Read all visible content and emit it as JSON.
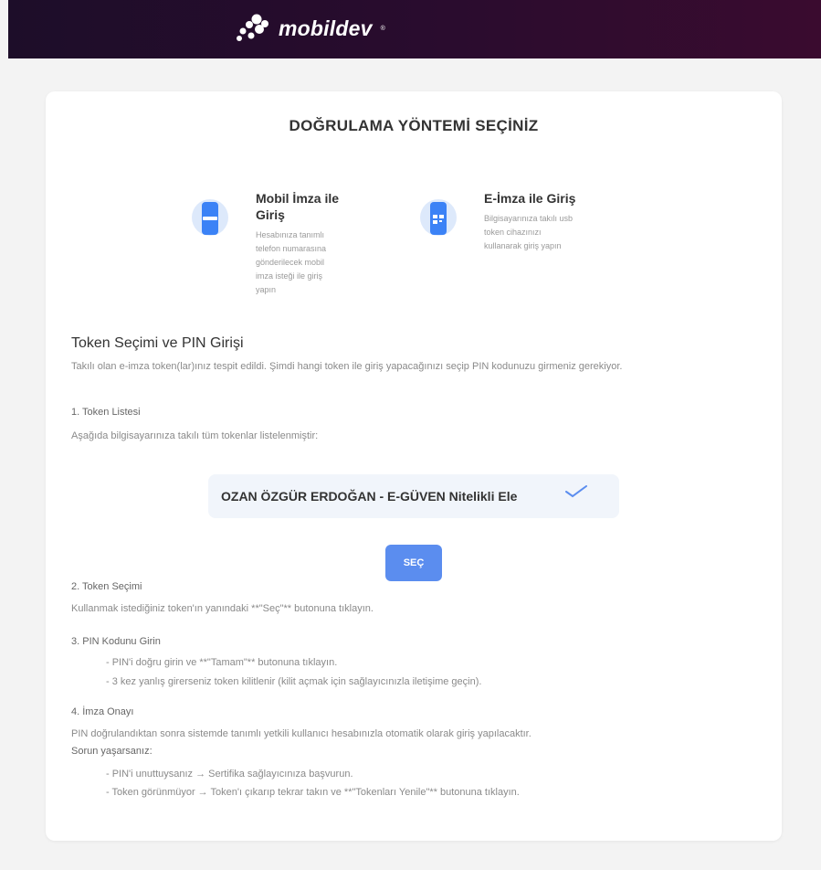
{
  "header": {
    "logo_text": "mobildev",
    "logo_mark": "®"
  },
  "page": {
    "title": "DOĞRULAMA YÖNTEMİ SEÇİNİZ"
  },
  "methods": [
    {
      "title_lines": [
        "Mobil İmza ile",
        "Giriş"
      ],
      "desc_lines": [
        "Hesabınıza tanımlı",
        "telefon numarasına",
        "gönderilecek mobil",
        "imza isteği ile giriş",
        "yapın"
      ],
      "icon": "mobile-signature-icon"
    },
    {
      "title_lines": [
        "E-İmza ile Giriş"
      ],
      "desc_lines": [
        "Bilgisayarınıza takılı usb",
        "token cihazınızı",
        "kullanarak giriş yapın"
      ],
      "icon": "qr-token-icon"
    }
  ],
  "token_section": {
    "title": "Token Seçimi ve PIN Girişi",
    "intro": "Takılı olan e-imza token(lar)ınız tespit edildi. Şimdi hangi token ile giriş yapacağınızı seçip PIN kodunuzu girmeniz gerekiyor.",
    "step1_title": "1. Token Listesi",
    "step1_text": "Aşağıda bilgisayarınıza takılı tüm tokenlar listelenmiştir:",
    "token_name": "OZAN ÖZGÜR ERDOĞAN - E-GÜVEN Nitelikli Ele",
    "select_button": "SEÇ",
    "step2_title": "2. Token Seçimi",
    "step2_text": "Kullanmak istediğiniz token'ın yanındaki **\"Seç\"** butonuna tıklayın.",
    "step3_title": "3. PIN Kodunu Girin",
    "step3_items": [
      "- PIN'i doğru girin ve **\"Tamam\"** butonuna tıklayın.",
      "- 3 kez yanlış girerseniz token kilitlenir (kilit açmak için sağlayıcınızla iletişime geçin)."
    ],
    "step4_title": "4. İmza Onayı",
    "step4_text": "PIN doğrulandıktan sonra sistemde tanımlı yetkili kullanıcı hesabınızla otomatik olarak giriş yapılacaktır.",
    "problems_title": "Sorun yaşarsanız:",
    "problem_items": [
      "- PIN'i unuttuysanız → Sertifika sağlayıcınıza başvurun.",
      "- Token görünmüyor → Token'ı çıkarıp tekrar takın ve **\"Tokenları Yenile\"** butonuna tıklayın."
    ]
  },
  "colors": {
    "header_bg": "#2a0c2e",
    "accent": "#5b8def",
    "icon_bg": "#dde9fb",
    "phone": "#3b82f6"
  }
}
